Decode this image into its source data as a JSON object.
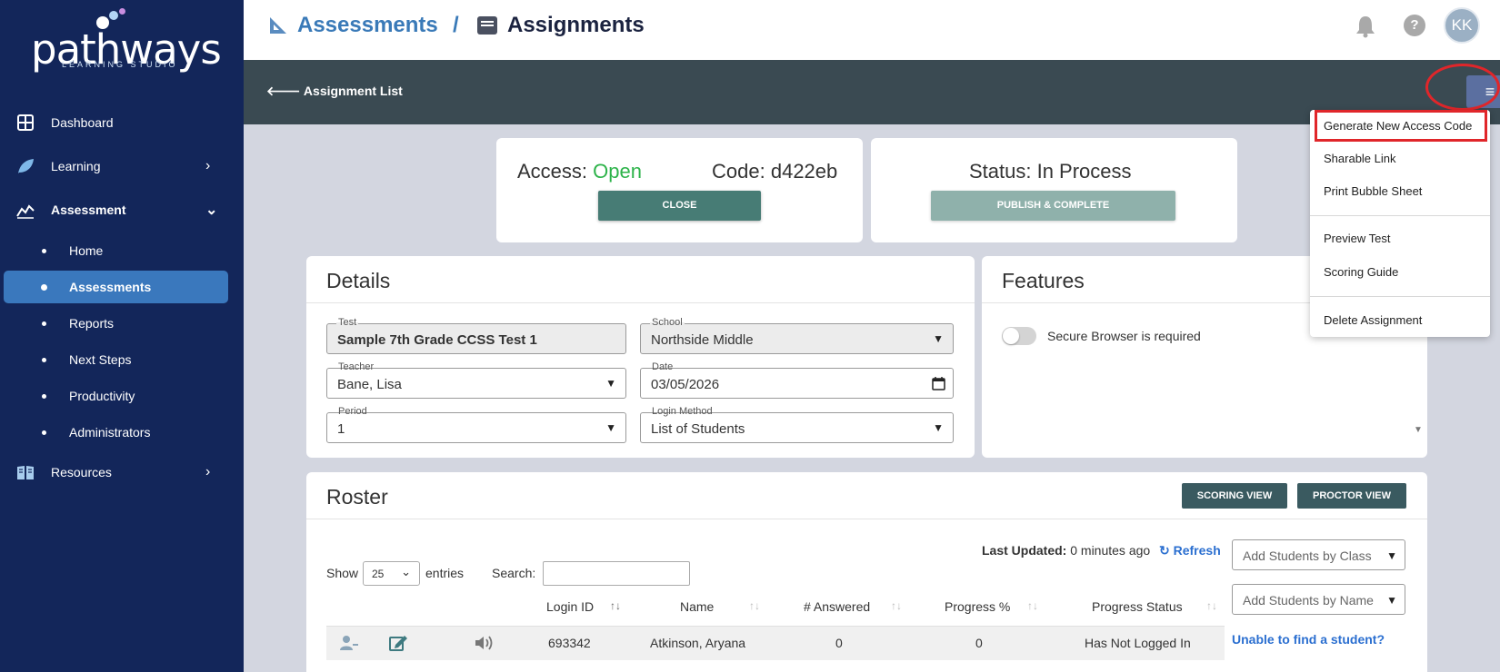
{
  "brand": {
    "name": "pathways",
    "tagline": "LEARNING STUDIO"
  },
  "sidebar": {
    "items": [
      {
        "label": "Dashboard"
      },
      {
        "label": "Learning"
      },
      {
        "label": "Assessment"
      },
      {
        "label": "Resources"
      }
    ],
    "subitems": [
      {
        "label": "Home"
      },
      {
        "label": "Assessments"
      },
      {
        "label": "Reports"
      },
      {
        "label": "Next Steps"
      },
      {
        "label": "Productivity"
      },
      {
        "label": "Administrators"
      }
    ]
  },
  "header": {
    "crumb_assessments": "Assessments",
    "crumb_sep": "/",
    "crumb_assignments": "Assignments",
    "help": "?",
    "avatar": "KK"
  },
  "band": {
    "back_label": "Assignment List",
    "menu_icon": "≡"
  },
  "menu": {
    "items": [
      "Generate New Access Code",
      "Sharable Link",
      "Print Bubble Sheet",
      "Preview Test",
      "Scoring Guide",
      "Delete Assignment"
    ]
  },
  "access": {
    "label": "Access:",
    "value": "Open",
    "code_label": "Code:",
    "code": "d422eb",
    "close_btn": "CLOSE"
  },
  "status": {
    "label": "Status: In Process",
    "publish_btn": "PUBLISH & COMPLETE"
  },
  "details": {
    "title": "Details",
    "test_label": "Test",
    "test_value": "Sample 7th Grade CCSS Test 1",
    "school_label": "School",
    "school_value": "Northside Middle",
    "teacher_label": "Teacher",
    "teacher_value": "Bane, Lisa",
    "date_label": "Date",
    "date_value": "03/05/2026",
    "period_label": "Period",
    "period_value": "1",
    "login_label": "Login Method",
    "login_value": "List of Students"
  },
  "features": {
    "title": "Features",
    "secure_label": "Secure Browser is required",
    "secure_on": false
  },
  "roster": {
    "title": "Roster",
    "scoring_btn": "SCORING VIEW",
    "proctor_btn": "PROCTOR VIEW",
    "last_updated_label": "Last Updated:",
    "last_updated_value": "0 minutes ago",
    "refresh": "Refresh",
    "show_label": "Show",
    "entries_value": "25",
    "entries_label": "entries",
    "search_label": "Search:",
    "search_value": "",
    "add_class": "Add Students by Class",
    "add_name": "Add Students by Name",
    "unable": "Unable to find a student?",
    "columns": [
      "Login ID",
      "Name",
      "# Answered",
      "Progress %",
      "Progress Status"
    ],
    "rows": [
      {
        "login_id": "693342",
        "name": "Atkinson, Aryana",
        "answered": "0",
        "progress": "0",
        "status": "Has Not Logged In"
      }
    ]
  },
  "colors": {
    "sidebar": "#13265a",
    "active": "#3a78bd",
    "band": "#3a4a52",
    "open": "#2db34a",
    "highlight": "#e0262a"
  }
}
